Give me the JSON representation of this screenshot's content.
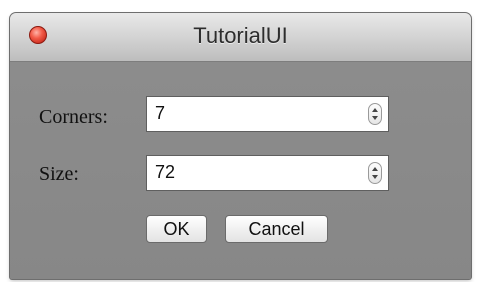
{
  "window": {
    "title": "TutorialUI",
    "close_icon": "close-icon"
  },
  "form": {
    "corners": {
      "label": "Corners:",
      "value": "7"
    },
    "size": {
      "label": "Size:",
      "value": "72"
    }
  },
  "buttons": {
    "ok_label": "OK",
    "cancel_label": "Cancel"
  }
}
